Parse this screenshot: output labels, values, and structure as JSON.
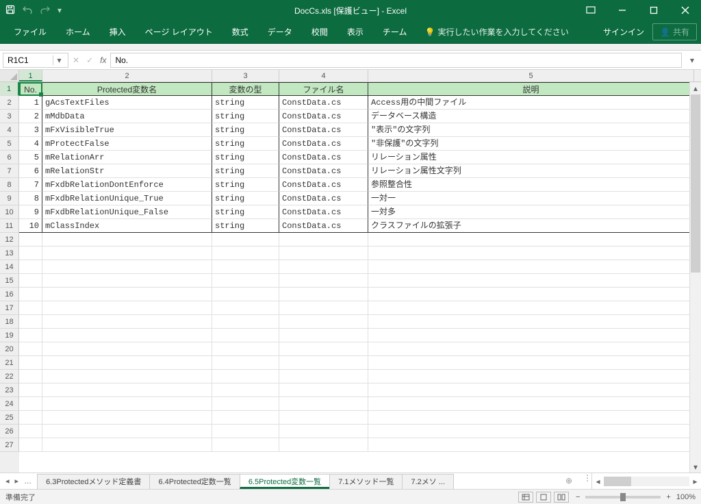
{
  "title": {
    "full": "DocCs.xls  [保護ビュー] - Excel"
  },
  "ribbon": {
    "tabs": [
      "ファイル",
      "ホーム",
      "挿入",
      "ページ レイアウト",
      "数式",
      "データ",
      "校閲",
      "表示",
      "チーム"
    ],
    "tellme": "実行したい作業を入力してください",
    "signin": "サインイン",
    "share": "共有"
  },
  "formula": {
    "namebox": "R1C1",
    "value": "No."
  },
  "grid": {
    "cols": [
      "1",
      "2",
      "3",
      "4",
      "5"
    ],
    "row_count": 27,
    "headers": [
      "No.",
      "Protected変数名",
      "変数の型",
      "ファイル名",
      "説明"
    ],
    "rows": [
      {
        "no": "1",
        "name": "gAcsTextFiles",
        "type": "string",
        "file": "ConstData.cs",
        "desc": "Access用の中間ファイル"
      },
      {
        "no": "2",
        "name": "mMdbData",
        "type": "string",
        "file": "ConstData.cs",
        "desc": "データベース構造"
      },
      {
        "no": "3",
        "name": "mFxVisibleTrue",
        "type": "string",
        "file": "ConstData.cs",
        "desc": "\"表示\"の文字列"
      },
      {
        "no": "4",
        "name": "mProtectFalse",
        "type": "string",
        "file": "ConstData.cs",
        "desc": "\"非保護\"の文字列"
      },
      {
        "no": "5",
        "name": "mRelationArr",
        "type": "string",
        "file": "ConstData.cs",
        "desc": "リレーション属性"
      },
      {
        "no": "6",
        "name": "mRelationStr",
        "type": "string",
        "file": "ConstData.cs",
        "desc": "リレーション属性文字列"
      },
      {
        "no": "7",
        "name": "mFxdbRelationDontEnforce",
        "type": "string",
        "file": "ConstData.cs",
        "desc": "参照整合性"
      },
      {
        "no": "8",
        "name": "mFxdbRelationUnique_True",
        "type": "string",
        "file": "ConstData.cs",
        "desc": "一対一"
      },
      {
        "no": "9",
        "name": "mFxdbRelationUnique_False",
        "type": "string",
        "file": "ConstData.cs",
        "desc": "一対多"
      },
      {
        "no": "10",
        "name": "mClassIndex",
        "type": "string",
        "file": "ConstData.cs",
        "desc": "クラスファイルの拡張子"
      }
    ]
  },
  "sheets": {
    "tabs": [
      {
        "label": "6.3Protectedメソッド定義書",
        "active": false
      },
      {
        "label": "6.4Protected定数一覧",
        "active": false
      },
      {
        "label": "6.5Protected変数一覧",
        "active": true
      },
      {
        "label": "7.1メソッド一覧",
        "active": false
      },
      {
        "label": "7.2メソ ...",
        "active": false,
        "trunc": true
      }
    ]
  },
  "status": {
    "ready": "準備完了",
    "zoom": "100%"
  }
}
